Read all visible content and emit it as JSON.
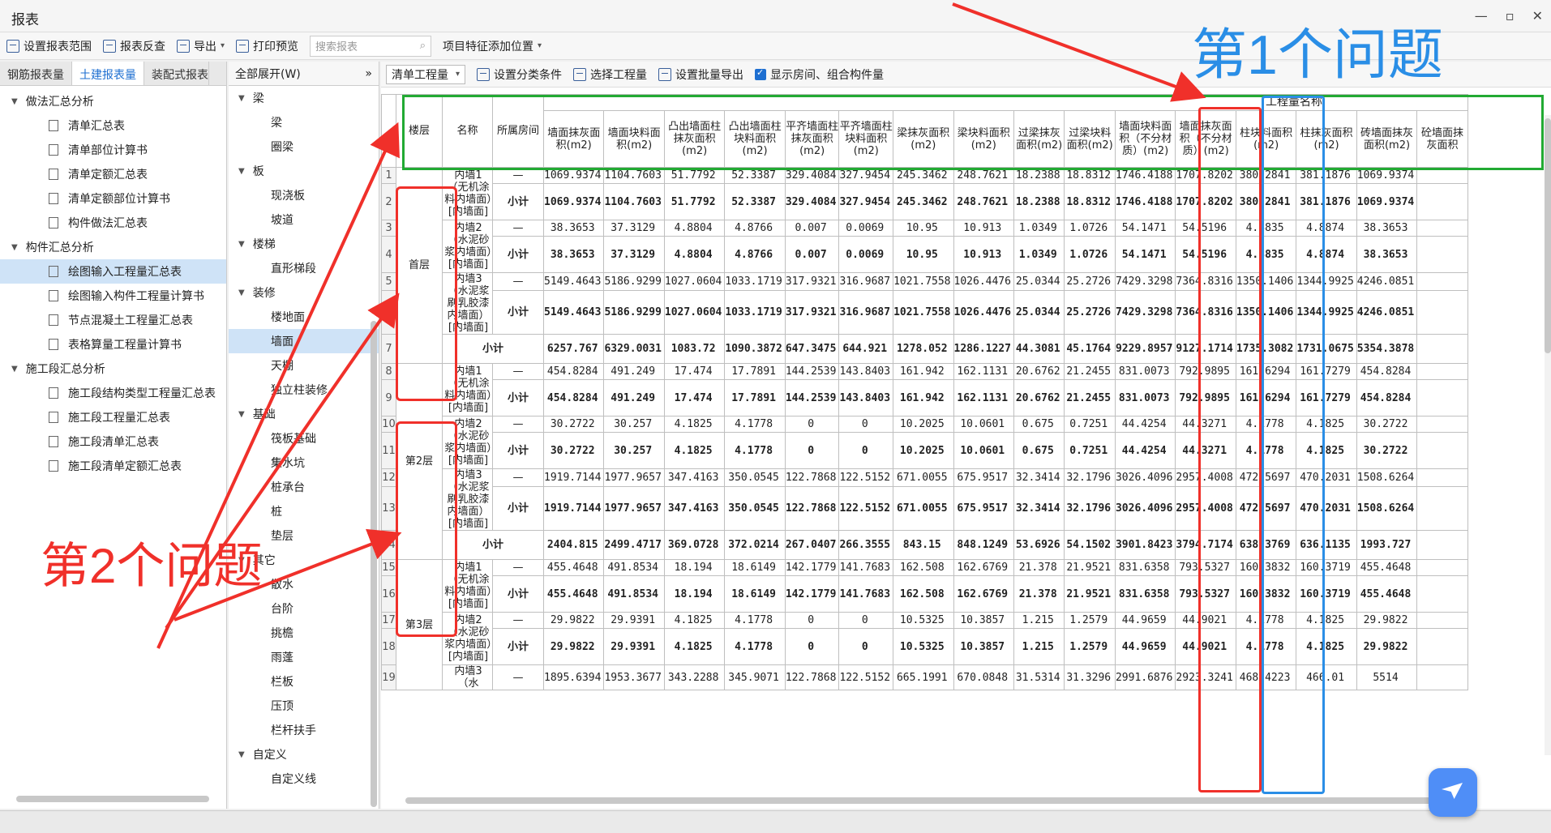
{
  "window": {
    "title": "报表",
    "controls": [
      "—",
      "▫",
      "✕"
    ]
  },
  "toolbar": {
    "items": [
      "设置报表范围",
      "报表反查",
      "导出",
      "打印预览"
    ],
    "search_placeholder": "搜索报表",
    "feature_position": "项目特征添加位置"
  },
  "left": {
    "tabs": [
      "钢筋报表量",
      "土建报表量",
      "装配式报表"
    ],
    "tree": [
      {
        "label": "做法汇总分析",
        "group": true
      },
      {
        "label": "清单汇总表"
      },
      {
        "label": "清单部位计算书"
      },
      {
        "label": "清单定额汇总表"
      },
      {
        "label": "清单定额部位计算书"
      },
      {
        "label": "构件做法汇总表"
      },
      {
        "label": "构件汇总分析",
        "group": true
      },
      {
        "label": "绘图输入工程量汇总表",
        "selected": true
      },
      {
        "label": "绘图输入构件工程量计算书"
      },
      {
        "label": "节点混凝土工程量汇总表"
      },
      {
        "label": "表格算量工程量计算书"
      },
      {
        "label": "施工段汇总分析",
        "group": true
      },
      {
        "label": "施工段结构类型工程量汇总表"
      },
      {
        "label": "施工段工程量汇总表"
      },
      {
        "label": "施工段清单汇总表"
      },
      {
        "label": "施工段清单定额汇总表"
      }
    ]
  },
  "middle": {
    "header": "全部展开(W)",
    "tree": [
      {
        "label": "梁",
        "group": true
      },
      {
        "label": "梁"
      },
      {
        "label": "圈梁"
      },
      {
        "label": "板",
        "group": true
      },
      {
        "label": "现浇板"
      },
      {
        "label": "坡道"
      },
      {
        "label": "楼梯",
        "group": true
      },
      {
        "label": "直形梯段"
      },
      {
        "label": "装修",
        "group": true
      },
      {
        "label": "楼地面"
      },
      {
        "label": "墙面",
        "selected": true
      },
      {
        "label": "天棚"
      },
      {
        "label": "独立柱装修"
      },
      {
        "label": "基础",
        "group": true
      },
      {
        "label": "筏板基础"
      },
      {
        "label": "集水坑"
      },
      {
        "label": "桩承台"
      },
      {
        "label": "桩"
      },
      {
        "label": "垫层"
      },
      {
        "label": "其它",
        "group": true
      },
      {
        "label": "散水"
      },
      {
        "label": "台阶"
      },
      {
        "label": "挑檐"
      },
      {
        "label": "雨蓬"
      },
      {
        "label": "栏板"
      },
      {
        "label": "压顶"
      },
      {
        "label": "栏杆扶手"
      },
      {
        "label": "自定义",
        "group": true
      },
      {
        "label": "自定义线"
      }
    ]
  },
  "right_toolbar": {
    "combo": "清单工程量",
    "items": [
      "设置分类条件",
      "选择工程量",
      "设置批量导出",
      "显示房间、组合构件量"
    ]
  },
  "table": {
    "group_header": "工程量名称",
    "fixed_headers": [
      "楼层",
      "名称",
      "所属房间"
    ],
    "columns": [
      "墙面抹灰面积(m2)",
      "墙面块料面积(m2)",
      "凸出墙面柱抹灰面积(m2)",
      "凸出墙面柱块料面积(m2)",
      "平齐墙面柱抹灰面积(m2)",
      "平齐墙面柱块料面积(m2)",
      "梁抹灰面积(m2)",
      "梁块料面积(m2)",
      "过梁抹灰面积(m2)",
      "过梁块料面积(m2)",
      "墙面块料面积（不分材质）(m2)",
      "墙面抹灰面积（不分材质）(m2)",
      "柱块料面积(m2)",
      "柱抹灰面积(m2)",
      "砖墙面抹灰面积(m2)",
      "砼墙面抹灰面积"
    ],
    "rows": [
      {
        "n": "1",
        "floor": "",
        "name": "内墙1（无机涂料内墙面）[内墙面]",
        "room": "—",
        "vals": [
          "1069.9374",
          "1104.7603",
          "51.7792",
          "52.3387",
          "329.4084",
          "327.9454",
          "245.3462",
          "248.7621",
          "18.2388",
          "18.8312",
          "1746.4188",
          "1707.8202",
          "380.2841",
          "381.1876",
          "1069.9374",
          ""
        ]
      },
      {
        "n": "2",
        "floor": "",
        "name": "",
        "room": "小计",
        "bold": true,
        "vals": [
          "1069.9374",
          "1104.7603",
          "51.7792",
          "52.3387",
          "329.4084",
          "327.9454",
          "245.3462",
          "248.7621",
          "18.2388",
          "18.8312",
          "1746.4188",
          "1707.8202",
          "380.2841",
          "381.1876",
          "1069.9374",
          ""
        ]
      },
      {
        "n": "3",
        "floor": "",
        "name": "内墙2（水泥砂浆内墙面）[内墙面]",
        "room": "—",
        "vals": [
          "38.3653",
          "37.3129",
          "4.8804",
          "4.8766",
          "0.007",
          "0.0069",
          "10.95",
          "10.913",
          "1.0349",
          "1.0726",
          "54.1471",
          "54.5196",
          "4.8835",
          "4.8874",
          "38.3653",
          ""
        ]
      },
      {
        "n": "4",
        "floor": "",
        "name": "",
        "room": "小计",
        "bold": true,
        "vals": [
          "38.3653",
          "37.3129",
          "4.8804",
          "4.8766",
          "0.007",
          "0.0069",
          "10.95",
          "10.913",
          "1.0349",
          "1.0726",
          "54.1471",
          "54.5196",
          "4.8835",
          "4.8874",
          "38.3653",
          ""
        ]
      },
      {
        "n": "5",
        "floor": "",
        "name": "内墙3（水泥浆刷乳胶漆内墙面）[内墙面]",
        "room": "—",
        "vals": [
          "5149.4643",
          "5186.9299",
          "1027.0604",
          "1033.1719",
          "317.9321",
          "316.9687",
          "1021.7558",
          "1026.4476",
          "25.0344",
          "25.2726",
          "7429.3298",
          "7364.8316",
          "1350.1406",
          "1344.9925",
          "4246.0851",
          ""
        ]
      },
      {
        "n": "6",
        "floor": "",
        "name": "",
        "room": "小计",
        "bold": true,
        "vals": [
          "5149.4643",
          "5186.9299",
          "1027.0604",
          "1033.1719",
          "317.9321",
          "316.9687",
          "1021.7558",
          "1026.4476",
          "25.0344",
          "25.2726",
          "7429.3298",
          "7364.8316",
          "1350.1406",
          "1344.9925",
          "4246.0851",
          ""
        ]
      },
      {
        "n": "7",
        "floor": "",
        "name": "小计",
        "room": "",
        "bold": true,
        "span": true,
        "vals": [
          "6257.767",
          "6329.0031",
          "1083.72",
          "1090.3872",
          "647.3475",
          "644.921",
          "1278.052",
          "1286.1227",
          "44.3081",
          "45.1764",
          "9229.8957",
          "9127.1714",
          "1735.3082",
          "1731.0675",
          "5354.3878",
          ""
        ]
      },
      {
        "n": "8",
        "floor": "",
        "name": "内墙1（无机涂料内墙面）[内墙面]",
        "room": "—",
        "vals": [
          "454.8284",
          "491.249",
          "17.474",
          "17.7891",
          "144.2539",
          "143.8403",
          "161.942",
          "162.1131",
          "20.6762",
          "21.2455",
          "831.0073",
          "792.9895",
          "161.6294",
          "161.7279",
          "454.8284",
          ""
        ]
      },
      {
        "n": "9",
        "floor": "",
        "name": "",
        "room": "小计",
        "bold": true,
        "vals": [
          "454.8284",
          "491.249",
          "17.474",
          "17.7891",
          "144.2539",
          "143.8403",
          "161.942",
          "162.1131",
          "20.6762",
          "21.2455",
          "831.0073",
          "792.9895",
          "161.6294",
          "161.7279",
          "454.8284",
          ""
        ]
      },
      {
        "n": "10",
        "floor": "",
        "name": "内墙2（水泥砂浆内墙面）[内墙面]",
        "room": "—",
        "vals": [
          "30.2722",
          "30.257",
          "4.1825",
          "4.1778",
          "0",
          "0",
          "10.2025",
          "10.0601",
          "0.675",
          "0.7251",
          "44.4254",
          "44.3271",
          "4.1778",
          "4.1825",
          "30.2722",
          ""
        ]
      },
      {
        "n": "11",
        "floor": "",
        "name": "",
        "room": "小计",
        "bold": true,
        "vals": [
          "30.2722",
          "30.257",
          "4.1825",
          "4.1778",
          "0",
          "0",
          "10.2025",
          "10.0601",
          "0.675",
          "0.7251",
          "44.4254",
          "44.3271",
          "4.1778",
          "4.1825",
          "30.2722",
          ""
        ]
      },
      {
        "n": "12",
        "floor": "",
        "name": "内墙3（水泥浆刷乳胶漆内墙面）[内墙面]",
        "room": "—",
        "vals": [
          "1919.7144",
          "1977.9657",
          "347.4163",
          "350.0545",
          "122.7868",
          "122.5152",
          "671.0055",
          "675.9517",
          "32.3414",
          "32.1796",
          "3026.4096",
          "2957.4008",
          "472.5697",
          "470.2031",
          "1508.6264",
          ""
        ]
      },
      {
        "n": "13",
        "floor": "",
        "name": "",
        "room": "小计",
        "bold": true,
        "vals": [
          "1919.7144",
          "1977.9657",
          "347.4163",
          "350.0545",
          "122.7868",
          "122.5152",
          "671.0055",
          "675.9517",
          "32.3414",
          "32.1796",
          "3026.4096",
          "2957.4008",
          "472.5697",
          "470.2031",
          "1508.6264",
          ""
        ]
      },
      {
        "n": "14",
        "floor": "",
        "name": "小计",
        "room": "",
        "bold": true,
        "span": true,
        "vals": [
          "2404.815",
          "2499.4717",
          "369.0728",
          "372.0214",
          "267.0407",
          "266.3555",
          "843.15",
          "848.1249",
          "53.6926",
          "54.1502",
          "3901.8423",
          "3794.7174",
          "638.3769",
          "636.1135",
          "1993.727",
          ""
        ]
      },
      {
        "n": "15",
        "floor": "",
        "name": "内墙1（无机涂料内墙面）[内墙面]",
        "room": "—",
        "vals": [
          "455.4648",
          "491.8534",
          "18.194",
          "18.6149",
          "142.1779",
          "141.7683",
          "162.508",
          "162.6769",
          "21.378",
          "21.9521",
          "831.6358",
          "793.5327",
          "160.3832",
          "160.3719",
          "455.4648",
          ""
        ]
      },
      {
        "n": "16",
        "floor": "",
        "name": "",
        "room": "小计",
        "bold": true,
        "vals": [
          "455.4648",
          "491.8534",
          "18.194",
          "18.6149",
          "142.1779",
          "141.7683",
          "162.508",
          "162.6769",
          "21.378",
          "21.9521",
          "831.6358",
          "793.5327",
          "160.3832",
          "160.3719",
          "455.4648",
          ""
        ]
      },
      {
        "n": "17",
        "floor": "",
        "name": "内墙2（水泥砂浆内墙面）[内墙面]",
        "room": "—",
        "vals": [
          "29.9822",
          "29.9391",
          "4.1825",
          "4.1778",
          "0",
          "0",
          "10.5325",
          "10.3857",
          "1.215",
          "1.2579",
          "44.9659",
          "44.9021",
          "4.1778",
          "4.1825",
          "29.9822",
          ""
        ]
      },
      {
        "n": "18",
        "floor": "",
        "name": "",
        "room": "小计",
        "bold": true,
        "vals": [
          "29.9822",
          "29.9391",
          "4.1825",
          "4.1778",
          "0",
          "0",
          "10.5325",
          "10.3857",
          "1.215",
          "1.2579",
          "44.9659",
          "44.9021",
          "4.1778",
          "4.1825",
          "29.9822",
          ""
        ]
      },
      {
        "n": "19",
        "floor": "",
        "name": "内墙3（水",
        "room": "—",
        "vals": [
          "1895.6394",
          "1953.3677",
          "343.2288",
          "345.9071",
          "122.7868",
          "122.5152",
          "665.1991",
          "670.0848",
          "31.5314",
          "31.3296",
          "2991.6876",
          "2923.3241",
          "468.4223",
          "466.01",
          "5514",
          ""
        ]
      }
    ],
    "floors": [
      {
        "label": "首层",
        "rows": [
          1,
          7
        ]
      },
      {
        "label": "第2层",
        "rows": [
          8,
          14
        ]
      },
      {
        "label": "第3层",
        "rows": [
          15,
          19
        ]
      }
    ]
  },
  "annotations": {
    "problem1": "第1个问题",
    "problem2": "第2个问题",
    "colors": {
      "red": "#f0302a",
      "blue": "#2a8ee6",
      "green": "#22aa33"
    }
  }
}
